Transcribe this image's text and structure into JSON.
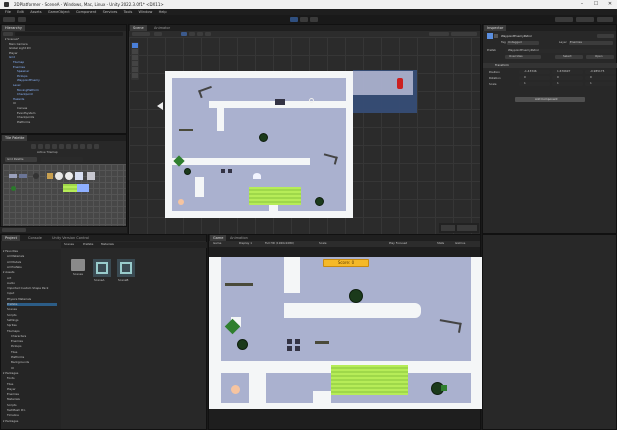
{
  "window": {
    "title": "2DPlatformer - SceneA - Windows, Mac, Linux - Unity 2022.3.0f1* <DX11>",
    "min": "–",
    "max": "☐",
    "close": "✕"
  },
  "menu": [
    "File",
    "Edit",
    "Assets",
    "GameObject",
    "Component",
    "Services",
    "Tools",
    "Window",
    "Help"
  ],
  "hierarchy": {
    "tab": "Hierarchy",
    "items": [
      "▾ SceneA*",
      "Main Camera",
      "Global Light 2D",
      "Player",
      "Grid",
      "Tilemap",
      "Enemies",
      "Spawner",
      "Pickups",
      "WaypointEnemy",
      "Level",
      "MovingPlatform",
      "Checkpoint",
      "Hazards",
      "UI",
      "Canvas",
      "EventSystem",
      "Checkpoints",
      "Platforms"
    ]
  },
  "tile_palette": {
    "tab": "Tile Palette",
    "palette_dropdown": "Grid Palette",
    "active_target": "Tilemap",
    "tools_label": "Active Tilemap"
  },
  "scene": {
    "tabs": [
      "Scene",
      "Animator"
    ],
    "mode_2d": "2D"
  },
  "inspector": {
    "tab": "Inspector",
    "object_name": "WaypointEnemyPatrol",
    "tag_label": "Tag",
    "tag_value": "Untagged",
    "layer_label": "Layer",
    "layer_value": "Enemies",
    "prefab_label": "Prefab",
    "prefab_value": "WaypointEnemyPatrol",
    "overrides": "Overrides",
    "select": "Select",
    "open": "Open",
    "transform": "Transform",
    "position_label": "Position",
    "rotation_label": "Rotation",
    "scale_label": "Scale",
    "position": [
      "-1.43346",
      "1.676697",
      "-0.985175"
    ],
    "rotation": [
      "0",
      "0",
      "0"
    ],
    "scale": [
      "1",
      "1",
      "1"
    ],
    "add_component": "Add Component"
  },
  "project": {
    "tabs": [
      "Project",
      "Console",
      "Unity Version Control"
    ],
    "subtabs": [
      "Scenes",
      "Prefabs",
      "Materials"
    ],
    "tree": [
      "▾ Favorites",
      "All Materials",
      "All Models",
      "All Prefabs",
      "▾ Assets",
      "Art",
      "Audio",
      "Imported Custom Shape Pack",
      "Input",
      "Physics Materials",
      "Prefabs",
      "Scenes",
      "Scripts",
      "Settings",
      "Sprites",
      "Tilemaps",
      "Characters",
      "Enemies",
      "Pickups",
      "Tiles",
      "Platforms",
      "Backgrounds",
      "UI",
      "▾ Packages",
      "Fonts",
      "Tiles",
      "Player",
      "Enemies",
      "Materials",
      "Scripts",
      "TextMesh Pro",
      "Timeline",
      "▾ Packages"
    ],
    "files": [
      {
        "name": "Scenes"
      },
      {
        "name": "SceneA"
      },
      {
        "name": "SceneB"
      }
    ]
  },
  "game": {
    "tabs": [
      "Game",
      "Animation"
    ],
    "display": "Display 1",
    "aspect": "Full HD (1920x1080)",
    "scale": "Scale",
    "play_focused": "Play Focused",
    "stats": "Stats",
    "gizmos": "Gizmos",
    "banner": "Score: 0"
  },
  "colors": {
    "accent": "#4a7fd8",
    "level_bg": "#aab1cf",
    "wall": "#f4f6f7",
    "goo": "#b6ec58",
    "banner": "#f5b928"
  }
}
